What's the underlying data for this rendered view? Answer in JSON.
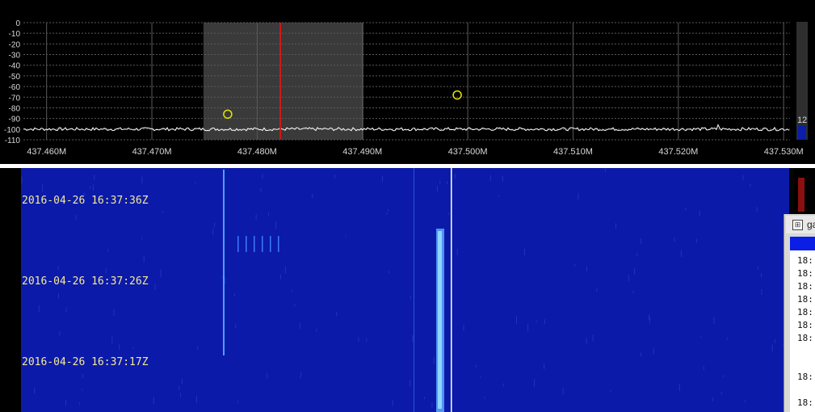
{
  "spectrum": {
    "y_ticks": [
      "0",
      "-10",
      "-20",
      "-30",
      "-40",
      "-50",
      "-60",
      "-70",
      "-80",
      "-90",
      "-100",
      "-110"
    ],
    "y_values": [
      0,
      -10,
      -20,
      -30,
      -40,
      -50,
      -60,
      -70,
      -80,
      -90,
      -100,
      -110
    ],
    "x_ticks": [
      "437.460M",
      "437.470M",
      "437.480M",
      "437.490M",
      "437.500M",
      "437.510M",
      "437.520M",
      "437.530M"
    ],
    "x_values": [
      437.46,
      437.47,
      437.48,
      437.49,
      437.5,
      437.51,
      437.52,
      437.53
    ],
    "x_range": [
      437.4578,
      437.5306
    ],
    "y_range": [
      0,
      -110
    ],
    "noise_floor_db": -100,
    "passband": [
      437.4749,
      437.4901
    ],
    "tuned_freq": 437.4822,
    "markers": [
      {
        "freq": 437.4772,
        "db": -89
      },
      {
        "freq": 437.499,
        "db": -71
      }
    ],
    "peaks": [
      {
        "freq": 437.4953,
        "db": -93
      },
      {
        "freq": 437.499,
        "db": -71
      },
      {
        "freq": 437.4772,
        "db": -89
      },
      {
        "freq": 437.5238,
        "db": -96
      }
    ],
    "level_readout": "12",
    "colors": {
      "grid": "#5a5a5a",
      "passband": "#3a3a3a",
      "trace": "#ffffff",
      "tuned": "#d01818",
      "marker": "#e6e600",
      "text": "#d8d8d8"
    }
  },
  "waterfall": {
    "timestamps": [
      "2016-04-26 16:37:36Z",
      "2016-04-26 16:37:26Z",
      "2016-04-26 16:37:17Z"
    ],
    "colors": {
      "background": "#0b1aa8",
      "signal": "#8fd6ff"
    }
  },
  "side_window": {
    "title": "ga",
    "log_lines": [
      "18:",
      "18:",
      "18:",
      "18:",
      "18:",
      "18:",
      "18:",
      "18:",
      "18:"
    ]
  }
}
